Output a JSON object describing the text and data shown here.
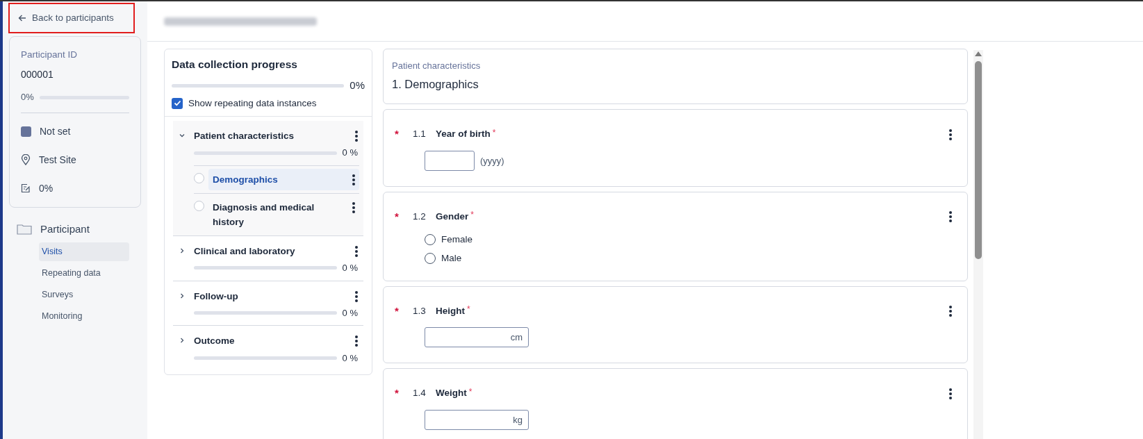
{
  "back_button": {
    "label": "Back to participants",
    "highlighted": true
  },
  "participant": {
    "id_label": "Participant ID",
    "id": "000001",
    "progress_text": "0%",
    "level": 0,
    "status": "Not set",
    "site": "Test Site",
    "forms_progress": "0%"
  },
  "nav": {
    "folder": "Participant",
    "items": [
      {
        "label": "Visits",
        "selected": true
      },
      {
        "label": "Repeating data",
        "selected": false
      },
      {
        "label": "Surveys",
        "selected": false
      },
      {
        "label": "Monitoring",
        "selected": false
      }
    ]
  },
  "progress_panel": {
    "title": "Data collection progress",
    "level": 0,
    "percent": "0%",
    "show_repeating": {
      "label": "Show repeating data instances",
      "checked": true
    },
    "sections": [
      {
        "label": "Patient characteristics",
        "expanded": true,
        "level": 0,
        "percent": "0 %",
        "children": [
          {
            "label": "Demographics",
            "selected": true
          },
          {
            "label": "Diagnosis and medical history",
            "selected": false
          }
        ]
      },
      {
        "label": "Clinical and laboratory",
        "expanded": false,
        "level": 0,
        "percent": "0 %"
      },
      {
        "label": "Follow-up",
        "expanded": false,
        "level": 0,
        "percent": "0 %"
      },
      {
        "label": "Outcome",
        "expanded": false,
        "level": 0,
        "percent": "0 %"
      }
    ]
  },
  "form": {
    "section": "Patient characteristics",
    "title": "1. Demographics",
    "required_mark": "*",
    "questions": [
      {
        "number": "1.1",
        "label": "Year of birth",
        "required": true,
        "kind": "input",
        "hint": "(yyyy)"
      },
      {
        "number": "1.2",
        "label": "Gender",
        "required": true,
        "kind": "radio",
        "options": [
          {
            "label": "Female",
            "selected": false
          },
          {
            "label": "Male",
            "selected": false
          }
        ]
      },
      {
        "number": "1.3",
        "label": "Height",
        "required": true,
        "kind": "unit",
        "unit": "cm"
      },
      {
        "number": "1.4",
        "label": "Weight",
        "required": true,
        "kind": "unit",
        "unit": "kg"
      }
    ]
  }
}
